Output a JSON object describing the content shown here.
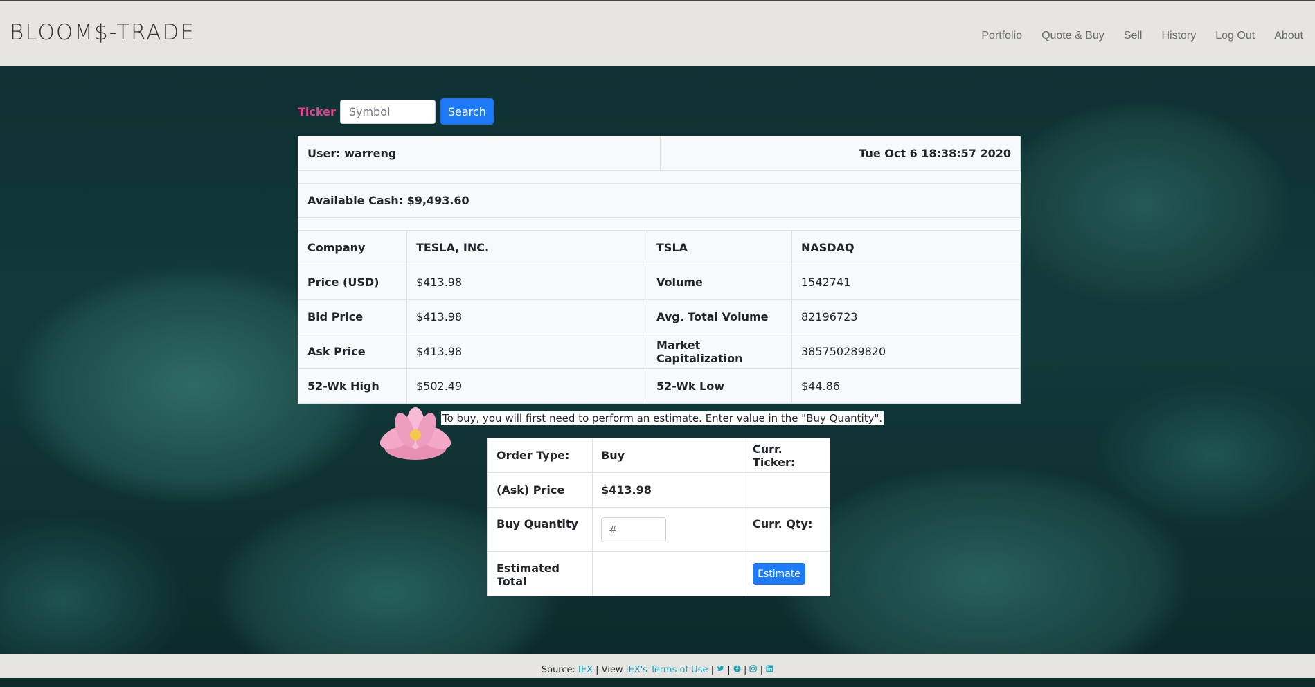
{
  "nav": {
    "brand": "BLOOM$-TRADE",
    "links": [
      "Portfolio",
      "Quote & Buy",
      "Sell",
      "History",
      "Log Out",
      "About"
    ]
  },
  "search": {
    "label": "Ticker",
    "placeholder": "Symbol",
    "button": "Search"
  },
  "info": {
    "user": "User: warreng",
    "timestamp": "Tue Oct 6 18:38:57 2020",
    "cash": "Available Cash: $9,493.60",
    "company_label": "Company",
    "company_name": "TESLA, INC.",
    "symbol": "TSLA",
    "exchange": "NASDAQ",
    "rows": [
      {
        "l1": "Price (USD)",
        "v1": "$413.98",
        "l2": "Volume",
        "v2": "1542741"
      },
      {
        "l1": "Bid Price",
        "v1": "$413.98",
        "l2": "Avg. Total Volume",
        "v2": "82196723"
      },
      {
        "l1": "Ask Price",
        "v1": "$413.98",
        "l2": "Market Capitalization",
        "v2": "385750289820"
      },
      {
        "l1": "52-Wk High",
        "v1": "$502.49",
        "l2": "52-Wk Low",
        "v2": "$44.86"
      }
    ]
  },
  "note": "To buy, you will first need to perform an estimate. Enter value in the \"Buy Quantity\".",
  "order": {
    "type_label": "Order Type:",
    "type_value": "Buy",
    "curr_ticker_label": "Curr. Ticker:",
    "price_label": "(Ask) Price",
    "price_value": "$413.98",
    "qty_label": "Buy Quantity",
    "qty_placeholder": "#",
    "curr_qty_label": "Curr. Qty:",
    "total_label": "Estimated Total",
    "estimate_button": "Estimate"
  },
  "footer": {
    "source_prefix": "Source:",
    "iex": "IEX",
    "view": "| View",
    "terms": "IEX's Terms of Use",
    "sep": "|",
    "icons": [
      "twitter-icon",
      "facebook-icon",
      "instagram-icon",
      "linkedin-icon"
    ]
  },
  "colors": {
    "accent": "#1f7af8",
    "ticker": "#e83e8c",
    "link": "#17a2b8"
  }
}
